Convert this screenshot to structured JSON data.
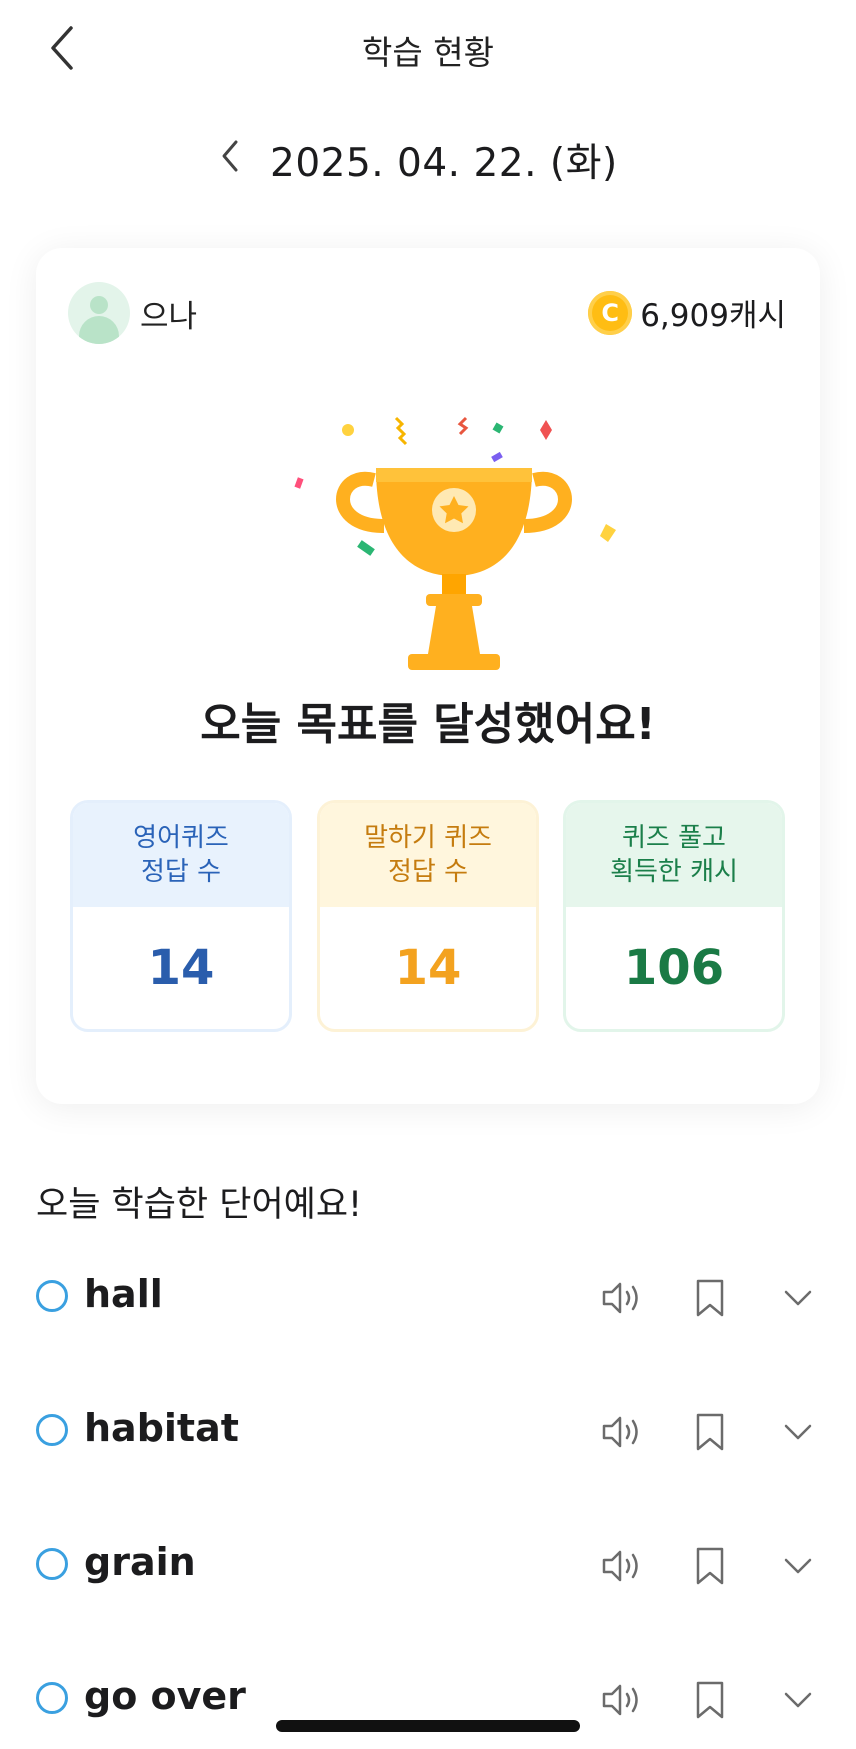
{
  "header": {
    "title": "학습 현황",
    "back_icon": "chevron-left-icon"
  },
  "date_nav": {
    "date": "2025. 04. 22. (화)",
    "prev_icon": "chevron-left-icon"
  },
  "card": {
    "user_name": "으나",
    "cash": "6,909캐시",
    "coin_symbol": "C",
    "goal_message": "오늘 목표를 달성했어요!",
    "stats": [
      {
        "label_line1": "영어퀴즈",
        "label_line2": "정답 수",
        "value": "14",
        "color": "#2a5dac"
      },
      {
        "label_line1": "말하기 퀴즈",
        "label_line2": "정답 수",
        "value": "14",
        "color": "#f3a21f"
      },
      {
        "label_line1": "퀴즈 풀고",
        "label_line2": "획득한 캐시",
        "value": "106",
        "color": "#1a7a45"
      }
    ]
  },
  "words_section": {
    "title": "오늘 학습한 단어예요!",
    "words": [
      {
        "word": "hall"
      },
      {
        "word": "habitat"
      },
      {
        "word": "grain"
      },
      {
        "word": "go over"
      }
    ]
  },
  "colors": {
    "accent_blue": "#3aa0e0",
    "trophy": "#ffb01f",
    "coin": "#ffbd13"
  }
}
